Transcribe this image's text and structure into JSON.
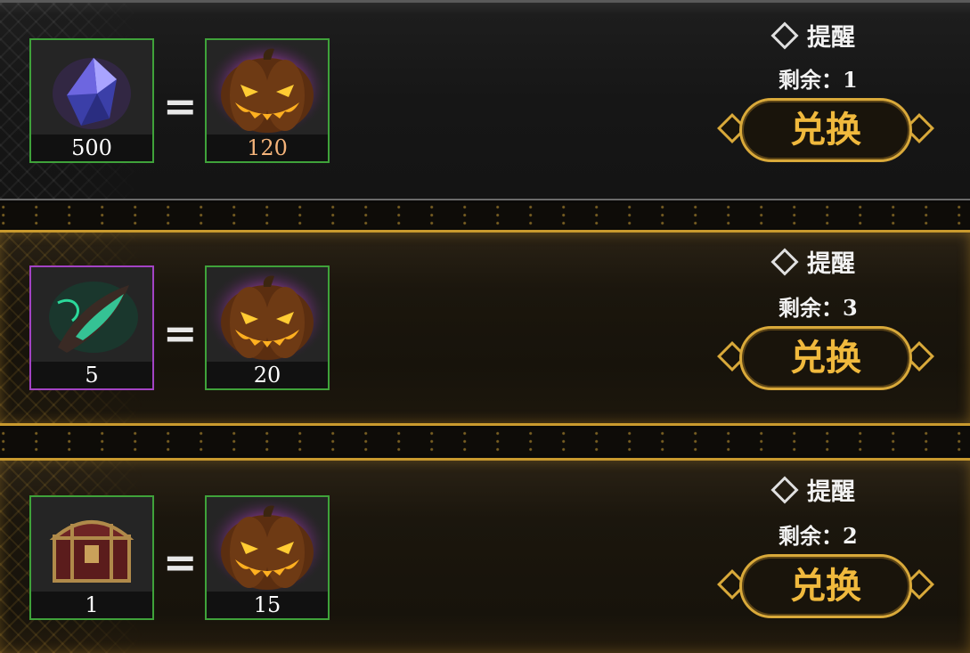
{
  "exchange_rows": [
    {
      "cost_item": {
        "icon": "purple-crystal-icon",
        "quantity": "500",
        "rarity_color": "#3fa23a"
      },
      "equals": "=",
      "reward_item": {
        "icon": "jack-o-lantern-icon",
        "quantity": "120",
        "quantity_color": "#f4b37a"
      },
      "remind_label": "提醒",
      "remaining_text": "剩余：1",
      "exchange_label": "兑换"
    },
    {
      "cost_item": {
        "icon": "green-feather-icon",
        "quantity": "5",
        "rarity_color": "#a343c4"
      },
      "equals": "=",
      "reward_item": {
        "icon": "jack-o-lantern-icon",
        "quantity": "20"
      },
      "remind_label": "提醒",
      "remaining_text": "剩余：3",
      "exchange_label": "兑换"
    },
    {
      "cost_item": {
        "icon": "treasure-chest-icon",
        "quantity": "1",
        "rarity_color": "#3fa23a"
      },
      "equals": "=",
      "reward_item": {
        "icon": "jack-o-lantern-icon",
        "quantity": "15"
      },
      "remind_label": "提醒",
      "remaining_text": "剩余：2",
      "exchange_label": "兑换"
    }
  ],
  "colors": {
    "gold": "#d9a93a",
    "button_text": "#f0b93d"
  }
}
